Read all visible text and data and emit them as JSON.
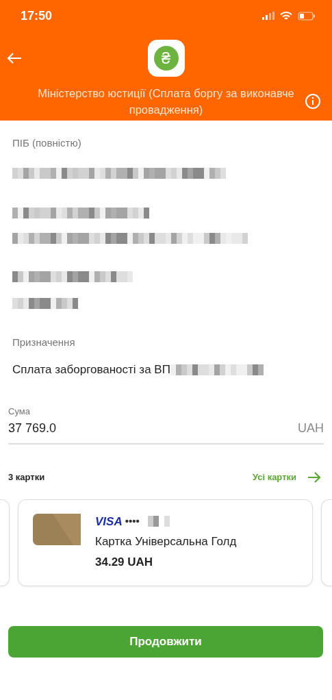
{
  "status_bar": {
    "time": "17:50"
  },
  "header": {
    "title": "Міністерство юстиції (Сплата боргу за виконавче провадження)",
    "logo_glyph": "₴"
  },
  "fields": [
    {
      "label": "ПІБ (повністю)"
    },
    {
      "label": "Призначення",
      "value": "Сплата заборгованості за  ВП"
    }
  ],
  "amount": {
    "label": "Сума",
    "value": "37 769.0",
    "currency": "UAH"
  },
  "cards_header": {
    "count": "3 картки",
    "link": "Усі картки"
  },
  "card": {
    "brand": "VISA",
    "mask": "••••",
    "name": "Картка Універсальна Голд",
    "balance": "34.29 UAH"
  },
  "button": "Продовжити"
}
